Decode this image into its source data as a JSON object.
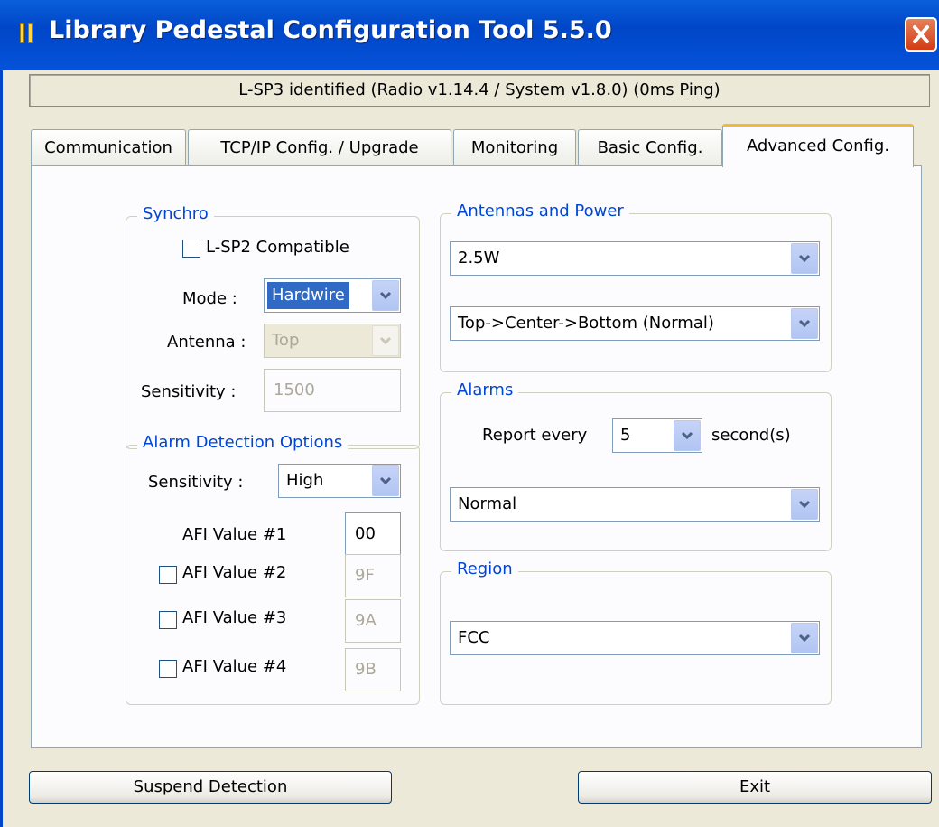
{
  "window": {
    "title": "Library Pedestal Configuration Tool 5.5.0"
  },
  "status": {
    "text": "L-SP3 identified (Radio v1.14.4 / System v1.8.0) (0ms Ping)"
  },
  "tabs": [
    {
      "label": "Communication"
    },
    {
      "label": "TCP/IP Config. / Upgrade"
    },
    {
      "label": "Monitoring"
    },
    {
      "label": "Basic Config."
    },
    {
      "label": "Advanced Config.",
      "active": true
    }
  ],
  "synchro": {
    "legend": "Synchro",
    "lsp2_label": "L-SP2 Compatible",
    "mode_label": "Mode :",
    "mode_value": "Hardwire",
    "antenna_label": "Antenna :",
    "antenna_value": "Top",
    "sensitivity_label": "Sensitivity :",
    "sensitivity_value": "1500"
  },
  "alarm_detection": {
    "legend": "Alarm Detection Options",
    "sensitivity_label": "Sensitivity :",
    "sensitivity_value": "High",
    "afi": [
      {
        "label": "AFI Value #1",
        "value": "00"
      },
      {
        "label": "AFI Value #2",
        "value": "9F"
      },
      {
        "label": "AFI Value #3",
        "value": "9A"
      },
      {
        "label": "AFI Value #4",
        "value": "9B"
      }
    ]
  },
  "antennas_power": {
    "legend": "Antennas and Power",
    "power_value": "2.5W",
    "sequence_value": "Top->Center->Bottom (Normal)"
  },
  "alarms": {
    "legend": "Alarms",
    "report_label": "Report every",
    "report_value": "5",
    "report_unit": "second(s)",
    "mode_value": "Normal"
  },
  "region": {
    "legend": "Region",
    "value": "FCC"
  },
  "buttons": {
    "suspend": "Suspend Detection",
    "exit": "Exit"
  },
  "colors": {
    "title_bar": "#0046c8",
    "legend_text": "#0046d5",
    "active_tab_accent": "#f2b836",
    "close_button": "#d23c14",
    "selected_highlight": "#316ac5"
  },
  "icons": {
    "app": "pedestal-icon",
    "close": "close-icon",
    "dropdown": "chevron-down-icon"
  }
}
